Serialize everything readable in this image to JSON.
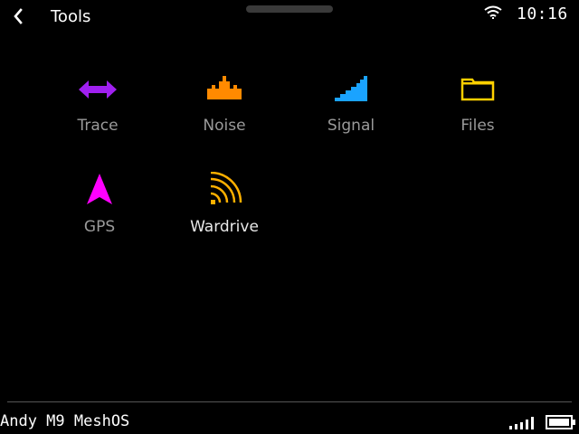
{
  "header": {
    "back_icon": "chevron-left-icon",
    "title": "Tools",
    "wifi_icon": "wifi-icon",
    "time": "10:16"
  },
  "tools": [
    {
      "label": "Trace",
      "icon": "double-arrow-icon",
      "color": "#a020f0"
    },
    {
      "label": "Noise",
      "icon": "noise-crown-icon",
      "color": "#ff8a00"
    },
    {
      "label": "Signal",
      "icon": "signal-ramp-icon",
      "color": "#1aa3ff"
    },
    {
      "label": "Files",
      "icon": "folder-icon",
      "color": "#ffd000"
    },
    {
      "label": "GPS",
      "icon": "gps-arrow-icon",
      "color": "#ff00ff"
    },
    {
      "label": "Wardrive",
      "icon": "wardrive-waves-icon",
      "color": "#ffb000",
      "selected": true
    }
  ],
  "footer": {
    "device_name": "Andy M9 MeshOS",
    "signal_icon": "signal-bars-icon",
    "battery_icon": "battery-icon"
  }
}
